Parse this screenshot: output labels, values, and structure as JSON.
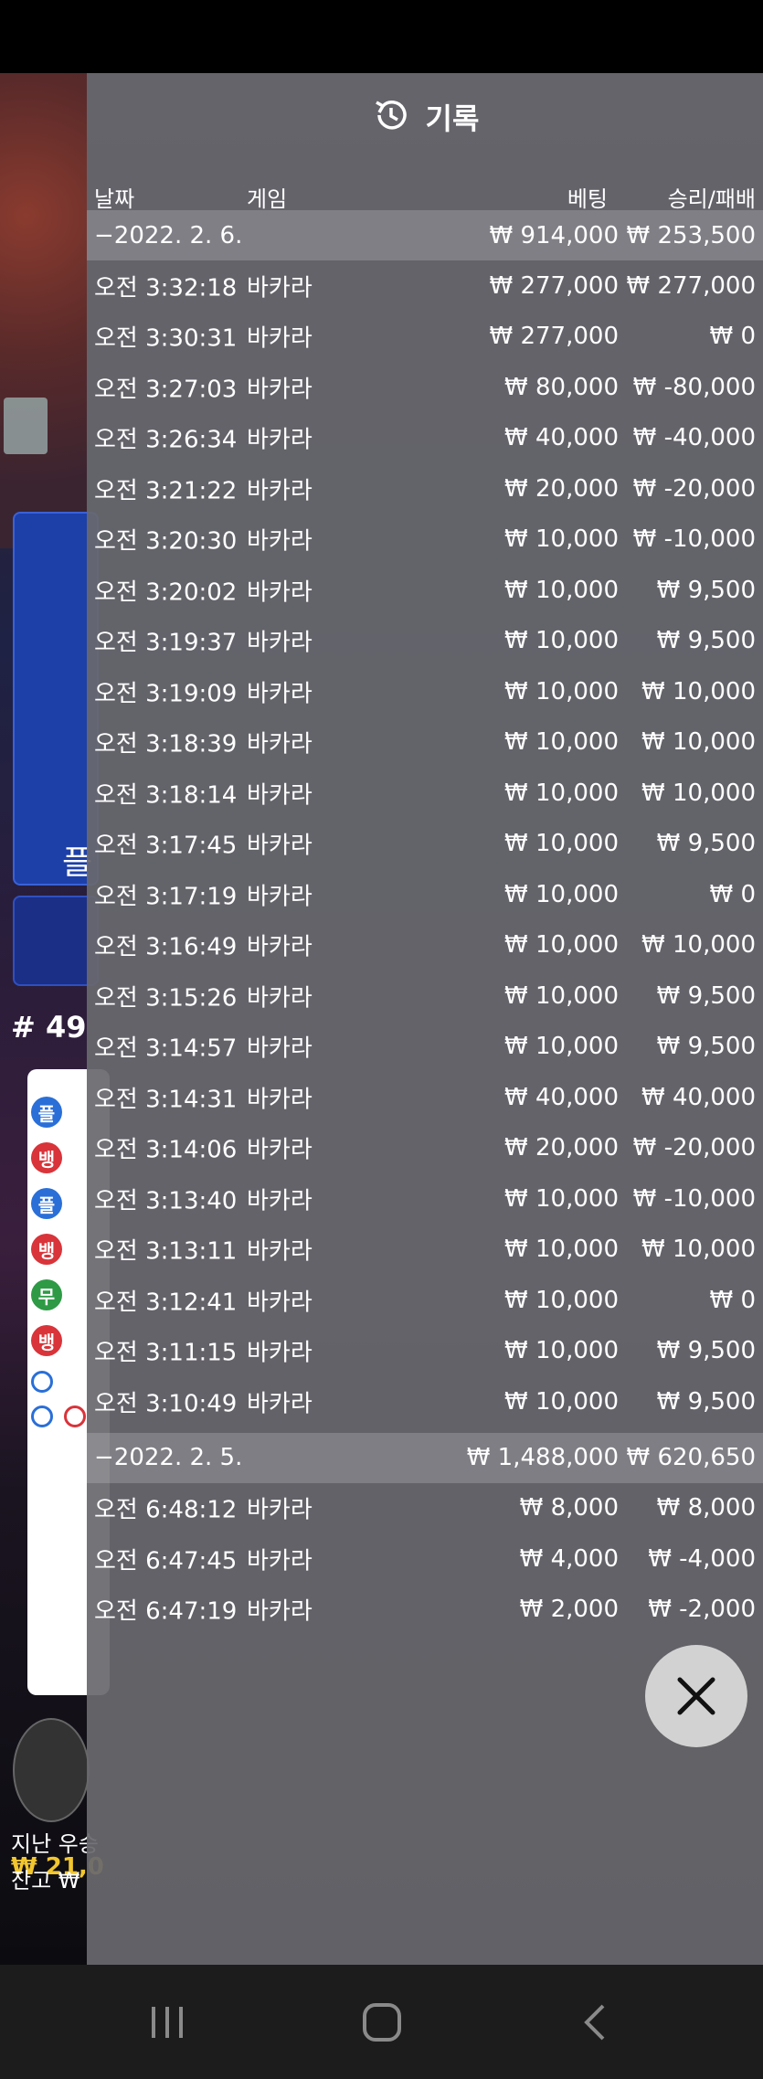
{
  "panel": {
    "title": "기록",
    "columns": {
      "date": "날짜",
      "game": "게임",
      "bet": "베팅",
      "result": "승리/패배"
    }
  },
  "days": [
    {
      "header": {
        "date": "−2022. 2. 6.",
        "bet": "₩ 914,000",
        "result": "₩ 253,500"
      },
      "rows": [
        {
          "time": "오전 3:32:18",
          "game": "바카라",
          "bet": "₩ 277,000",
          "result": "₩ 277,000"
        },
        {
          "time": "오전 3:30:31",
          "game": "바카라",
          "bet": "₩ 277,000",
          "result": "₩ 0"
        },
        {
          "time": "오전 3:27:03",
          "game": "바카라",
          "bet": "₩ 80,000",
          "result": "₩ -80,000"
        },
        {
          "time": "오전 3:26:34",
          "game": "바카라",
          "bet": "₩ 40,000",
          "result": "₩ -40,000"
        },
        {
          "time": "오전 3:21:22",
          "game": "바카라",
          "bet": "₩ 20,000",
          "result": "₩ -20,000"
        },
        {
          "time": "오전 3:20:30",
          "game": "바카라",
          "bet": "₩ 10,000",
          "result": "₩ -10,000"
        },
        {
          "time": "오전 3:20:02",
          "game": "바카라",
          "bet": "₩ 10,000",
          "result": "₩ 9,500"
        },
        {
          "time": "오전 3:19:37",
          "game": "바카라",
          "bet": "₩ 10,000",
          "result": "₩ 9,500"
        },
        {
          "time": "오전 3:19:09",
          "game": "바카라",
          "bet": "₩ 10,000",
          "result": "₩ 10,000"
        },
        {
          "time": "오전 3:18:39",
          "game": "바카라",
          "bet": "₩ 10,000",
          "result": "₩ 10,000"
        },
        {
          "time": "오전 3:18:14",
          "game": "바카라",
          "bet": "₩ 10,000",
          "result": "₩ 10,000"
        },
        {
          "time": "오전 3:17:45",
          "game": "바카라",
          "bet": "₩ 10,000",
          "result": "₩ 9,500"
        },
        {
          "time": "오전 3:17:19",
          "game": "바카라",
          "bet": "₩ 10,000",
          "result": "₩ 0"
        },
        {
          "time": "오전 3:16:49",
          "game": "바카라",
          "bet": "₩ 10,000",
          "result": "₩ 10,000"
        },
        {
          "time": "오전 3:15:26",
          "game": "바카라",
          "bet": "₩ 10,000",
          "result": "₩ 9,500"
        },
        {
          "time": "오전 3:14:57",
          "game": "바카라",
          "bet": "₩ 10,000",
          "result": "₩ 9,500"
        },
        {
          "time": "오전 3:14:31",
          "game": "바카라",
          "bet": "₩ 40,000",
          "result": "₩ 40,000"
        },
        {
          "time": "오전 3:14:06",
          "game": "바카라",
          "bet": "₩ 20,000",
          "result": "₩ -20,000"
        },
        {
          "time": "오전 3:13:40",
          "game": "바카라",
          "bet": "₩ 10,000",
          "result": "₩ -10,000"
        },
        {
          "time": "오전 3:13:11",
          "game": "바카라",
          "bet": "₩ 10,000",
          "result": "₩ 10,000"
        },
        {
          "time": "오전 3:12:41",
          "game": "바카라",
          "bet": "₩ 10,000",
          "result": "₩ 0"
        },
        {
          "time": "오전 3:11:15",
          "game": "바카라",
          "bet": "₩ 10,000",
          "result": "₩ 9,500"
        },
        {
          "time": "오전 3:10:49",
          "game": "바카라",
          "bet": "₩ 10,000",
          "result": "₩ 9,500"
        }
      ]
    },
    {
      "header": {
        "date": "−2022. 2. 5.",
        "bet": "₩ 1,488,000",
        "result": "₩ 620,650"
      },
      "rows": [
        {
          "time": "오전 6:48:12",
          "game": "바카라",
          "bet": "₩ 8,000",
          "result": "₩ 8,000"
        },
        {
          "time": "오전 6:47:45",
          "game": "바카라",
          "bet": "₩ 4,000",
          "result": "₩ -4,000"
        },
        {
          "time": "오전 6:47:19",
          "game": "바카라",
          "bet": "₩ 2,000",
          "result": "₩ -2,000"
        }
      ]
    }
  ],
  "background": {
    "big_label": "플",
    "round_number": "# 49",
    "balance": "₩ 21,0",
    "last_win_label": "지난 우승",
    "balance_label": "잔고 ₩"
  },
  "colors": {
    "panel_bg": "#68686e",
    "day_row_bg": "#8c8c92",
    "close_button": "#d2d2d2",
    "balance": "#f2c62e"
  }
}
